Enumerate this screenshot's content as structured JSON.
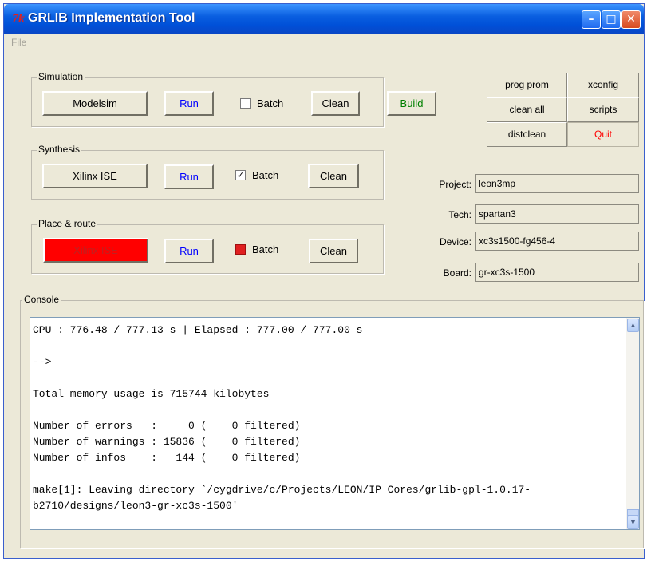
{
  "window": {
    "title": "GRLIB Implementation Tool",
    "tk_logo": "7k"
  },
  "menu": {
    "file": "File"
  },
  "simulation": {
    "label": "Simulation",
    "tool": "Modelsim",
    "run": "Run",
    "batch": "Batch",
    "batch_checked": false,
    "clean": "Clean",
    "build": "Build"
  },
  "synthesis": {
    "label": "Synthesis",
    "tool": "Xilinx ISE",
    "run": "Run",
    "batch": "Batch",
    "batch_checked": true,
    "clean": "Clean"
  },
  "place_route": {
    "label": "Place & route",
    "tool": "Xilinx ISE",
    "run": "Run",
    "batch": "Batch",
    "batch_checked": true,
    "clean": "Clean"
  },
  "right_buttons": {
    "prog_prom": "prog prom",
    "xconfig": "xconfig",
    "clean_all": "clean all",
    "scripts": "scripts",
    "distclean": "distclean",
    "quit": "Quit"
  },
  "info": {
    "project_label": "Project:",
    "project": "leon3mp",
    "tech_label": "Tech:",
    "tech": "spartan3",
    "device_label": "Device:",
    "device": "xc3s1500-fg456-4",
    "board_label": "Board:",
    "board": "gr-xc3s-1500"
  },
  "console": {
    "label": "Console",
    "text": "CPU : 776.48 / 777.13 s | Elapsed : 777.00 / 777.00 s\n\n-->\n\nTotal memory usage is 715744 kilobytes\n\nNumber of errors   :     0 (    0 filtered)\nNumber of warnings : 15836 (    0 filtered)\nNumber of infos    :   144 (    0 filtered)\n\nmake[1]: Leaving directory `/cygdrive/c/Projects/LEON/IP Cores/grlib-gpl-1.0.17-b2710/designs/leon3-gr-xc3s-1500'"
  },
  "colors": {
    "title_blue": "#0050d8",
    "face": "#ece9d8",
    "red": "#ff0000",
    "run_blue": "#0000ff",
    "build_green": "#008000"
  },
  "icons": {
    "minimize": "minimize-icon",
    "maximize": "maximize-icon",
    "close": "close-icon",
    "scroll_up": "scroll-up-arrow-icon",
    "scroll_down": "scroll-down-arrow-icon"
  }
}
